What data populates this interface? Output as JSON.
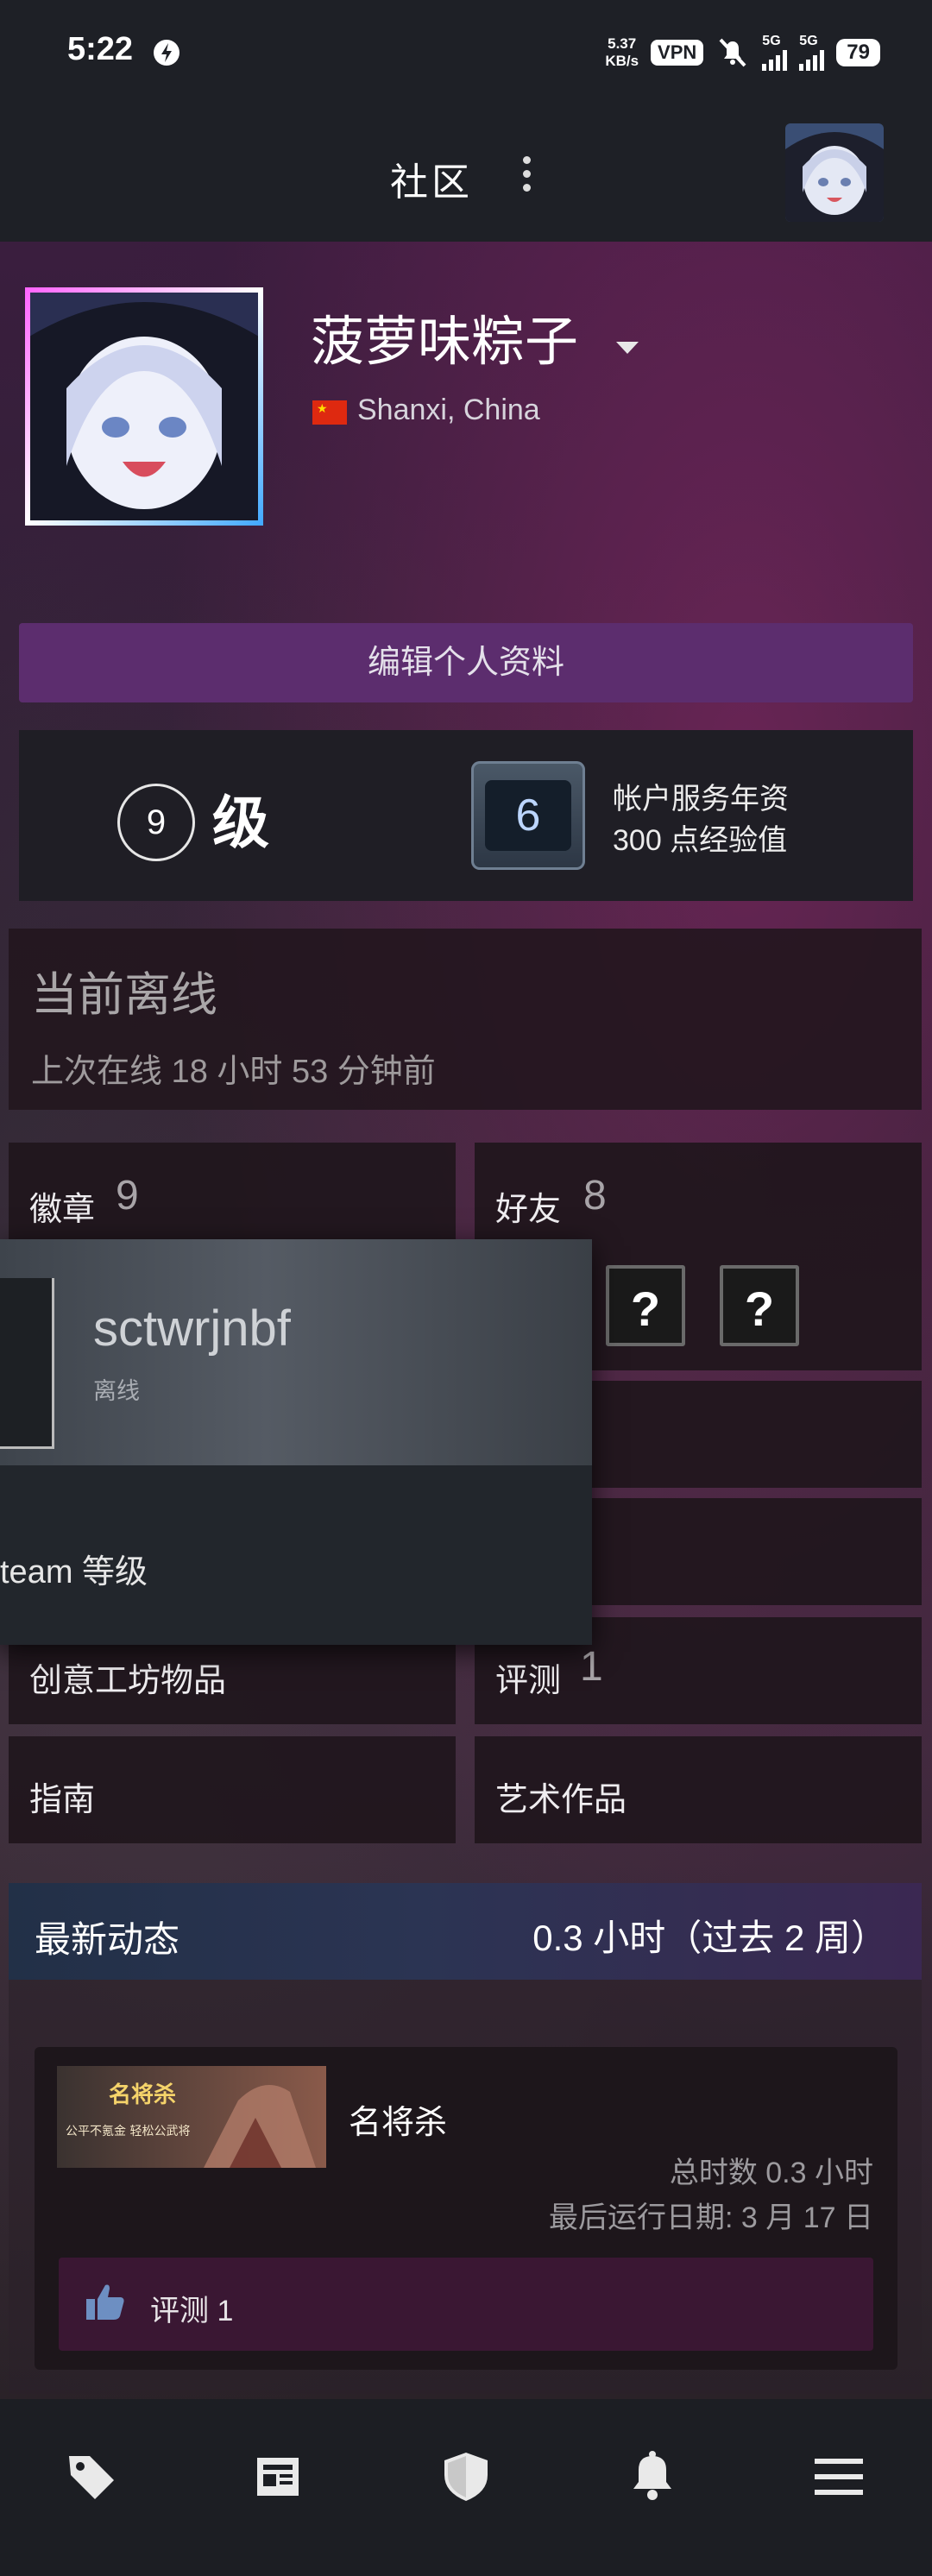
{
  "status_bar": {
    "time": "5:22",
    "net_speed_value": "5.37",
    "net_speed_unit": "KB/s",
    "vpn": "VPN",
    "signal_1": "5G",
    "signal_2": "5G",
    "battery": "79"
  },
  "header": {
    "title": "社区"
  },
  "profile": {
    "name": "菠萝味粽子",
    "location": "Shanxi, China",
    "edit_button": "编辑个人资料",
    "level_number": "9",
    "level_label": "级",
    "years_badge_number": "6",
    "years_title": "帐户服务年资",
    "years_xp": "300 点经验值",
    "status_title": "当前离线",
    "last_online": "上次在线 18 小时 53 分钟前"
  },
  "tiles": {
    "badges_label": "徽章",
    "badges_count": "9",
    "friends_label": "好友",
    "friends_count": "8",
    "workshop_label": "创意工坊物品",
    "reviews_label": "评测",
    "reviews_count": "1",
    "guides_label": "指南",
    "artwork_label": "艺术作品"
  },
  "popup": {
    "name": "sctwrjnbf",
    "status": "离线",
    "level_text": "team 等级"
  },
  "recent_activity": {
    "title": "最新动态",
    "hours": "0.3 小时（过去 2 周）",
    "game": {
      "name": "名将杀",
      "capsule_text": "名将杀",
      "capsule_subtext": "公平不氪金 轻松公武将",
      "total_hours": "总时数 0.3 小时",
      "last_played": "最后运行日期: 3 月 17 日",
      "review": "评测 1"
    }
  },
  "bottom_nav": {
    "items": [
      "store-tag-icon",
      "news-icon",
      "guard-shield-icon",
      "notifications-bell-icon",
      "menu-icon"
    ]
  },
  "colors": {
    "accent_purple": "#5c2d6e",
    "header_bg": "#1e2026",
    "review_bar": "#3a1733"
  }
}
